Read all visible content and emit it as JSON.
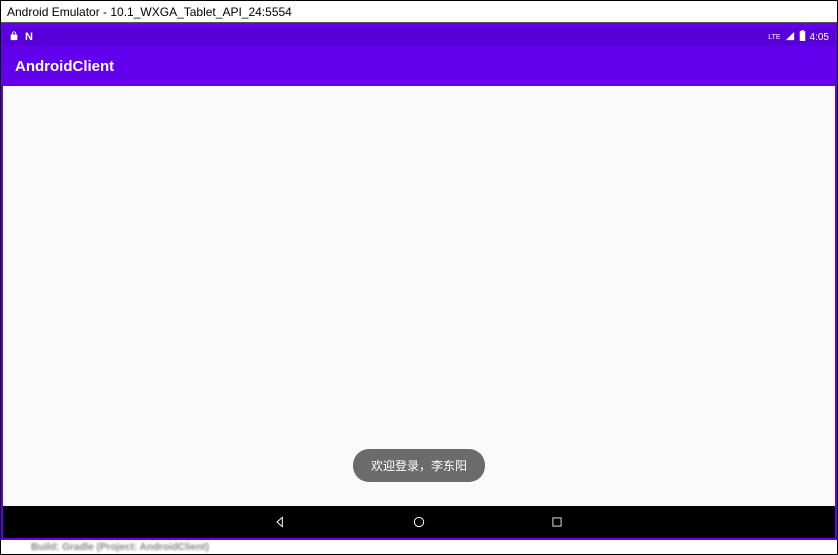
{
  "window": {
    "title": "Android Emulator - 10.1_WXGA_Tablet_API_24:5554"
  },
  "status_bar": {
    "n_label": "N",
    "lte_label": "LTE",
    "time": "4:05"
  },
  "app_bar": {
    "title": "AndroidClient"
  },
  "toast": {
    "message": "欢迎登录，李东阳"
  },
  "bottom_strip": {
    "text": "Build: Gradle (Project: AndroidClient)"
  }
}
